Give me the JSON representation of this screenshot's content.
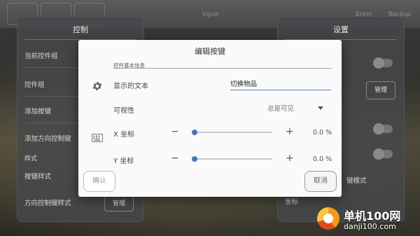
{
  "background": {
    "top_labels": [
      "Input",
      "Enter",
      "Backsp"
    ],
    "left_panel": {
      "title": "控制",
      "items": [
        "当前控件组",
        "控件组",
        "添加按键",
        "添加方向控制键",
        "按键样式",
        "方向控制键样式"
      ],
      "section": "样式",
      "manage_label": "管理"
    },
    "right_panel": {
      "title": "设置",
      "manage_label": "管理",
      "mode_label": "键模式",
      "coords_label": "坐标"
    }
  },
  "modal": {
    "title": "编辑按键",
    "section_label": "控件基本信息",
    "display_text_label": "显示的文本",
    "display_text_value": "切换物品",
    "visibility_label": "可视性",
    "visibility_value": "总是可见",
    "x_label": "X 坐标",
    "x_value_text": "0.0 %",
    "x_value": 0.0,
    "y_label": "Y 坐标",
    "y_value_text": "0.0 %",
    "y_value": 0.0,
    "confirm_label": "确认",
    "cancel_label": "取消"
  },
  "watermark": {
    "title": "单机100网",
    "url": "danji100.com"
  },
  "colors": {
    "accent": "#4a76b8",
    "modal_bg": "#fafafa"
  },
  "icons": [
    "gear-icon",
    "keyboard-icon",
    "minus-icon",
    "plus-icon",
    "chevron-down-icon"
  ]
}
